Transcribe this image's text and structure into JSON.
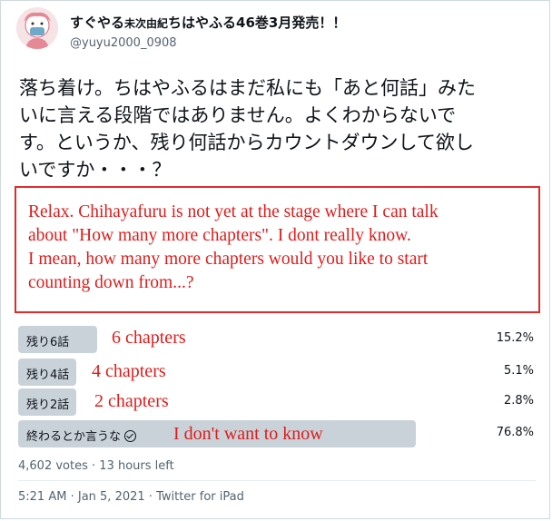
{
  "user": {
    "name_main": "すぐやる",
    "name_small": "未次由紀",
    "name_rest": "ちはやふる46巻3月発売！！",
    "handle": "@yuyu2000_0908"
  },
  "tweet": {
    "lines": [
      "落ち着け。ちはやふるはまだ私にも「あと何話」みた",
      "いに言える段階ではありません。よくわからないで",
      "す。というか、残り何話からカウントダウンして欲し",
      "いですか・・・？"
    ]
  },
  "translation": {
    "lines": [
      "Relax. Chihayafuru is not yet at the stage where I can talk",
      "about \"How many more chapters\". I dont really know.",
      "I mean, how many more chapters would you like to start",
      "counting down from...?"
    ]
  },
  "poll": {
    "options": [
      {
        "label": "残り6話",
        "translation": "6 chapters",
        "percent": "15.2%",
        "fraction": 0.152,
        "selected": false
      },
      {
        "label": "残り4話",
        "translation": "4 chapters",
        "percent": "5.1%",
        "fraction": 0.051,
        "selected": false
      },
      {
        "label": "残り2話",
        "translation": "2 chapters",
        "percent": "2.8%",
        "fraction": 0.028,
        "selected": false
      },
      {
        "label": "終わるとか言うな",
        "translation": "I don't want to know",
        "percent": "76.8%",
        "fraction": 0.768,
        "selected": true
      }
    ],
    "votes": "4,602 votes",
    "separator": "·",
    "time_left": "13 hours left"
  },
  "footer": {
    "time": "5:21 AM",
    "date": "Jan 5, 2021",
    "source": "Twitter for iPad",
    "separator": "·"
  },
  "colors": {
    "translation_red": "#e01b1b",
    "bar": "#c8d2d8",
    "muted": "#536471"
  }
}
